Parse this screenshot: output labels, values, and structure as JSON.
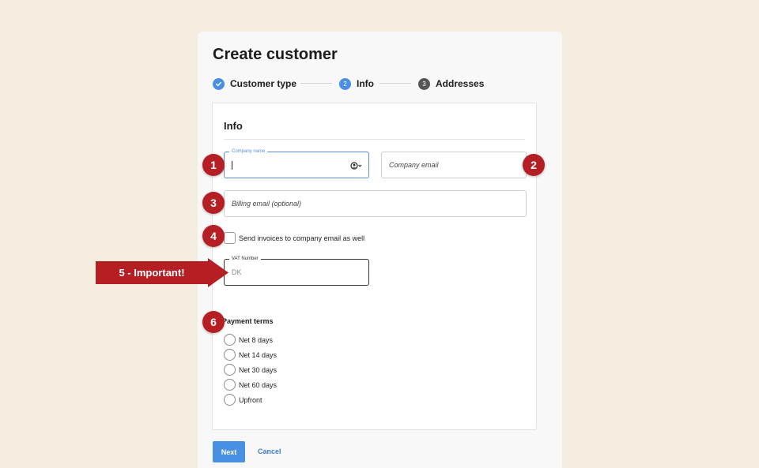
{
  "title": "Create customer",
  "stepper": {
    "steps": [
      {
        "number": "✓",
        "label": "Customer type",
        "state": "done"
      },
      {
        "number": "2",
        "label": "Info",
        "state": "current"
      },
      {
        "number": "3",
        "label": "Addresses",
        "state": "upcoming"
      }
    ]
  },
  "card": {
    "title": "Info",
    "company_name": {
      "label": "Company name",
      "value": ""
    },
    "company_email": {
      "placeholder": "Company email"
    },
    "billing_email": {
      "placeholder": "Billing email (optional)"
    },
    "send_invoices": {
      "label": "Send invoices to company email as well",
      "checked": false
    },
    "vat_number": {
      "label": "VAT Number",
      "placeholder": "DK"
    },
    "payment_terms": {
      "title": "Payment terms",
      "options": [
        "Net 8 days",
        "Net 14 days",
        "Net 30 days",
        "Net 60 days",
        "Upfront"
      ]
    }
  },
  "actions": {
    "next_label": "Next",
    "cancel_label": "Cancel"
  },
  "annotations": {
    "badges": [
      "1",
      "2",
      "3",
      "4",
      "6"
    ],
    "banner_label": "5 - Important!"
  },
  "colors": {
    "background": "#f4ede0",
    "accent": "#4a90e2",
    "annotation": "#b51e22",
    "step_upcoming": "#555555"
  },
  "icons": {
    "step1": "check-icon",
    "company_name_adornment": "person-dropdown-icon"
  }
}
